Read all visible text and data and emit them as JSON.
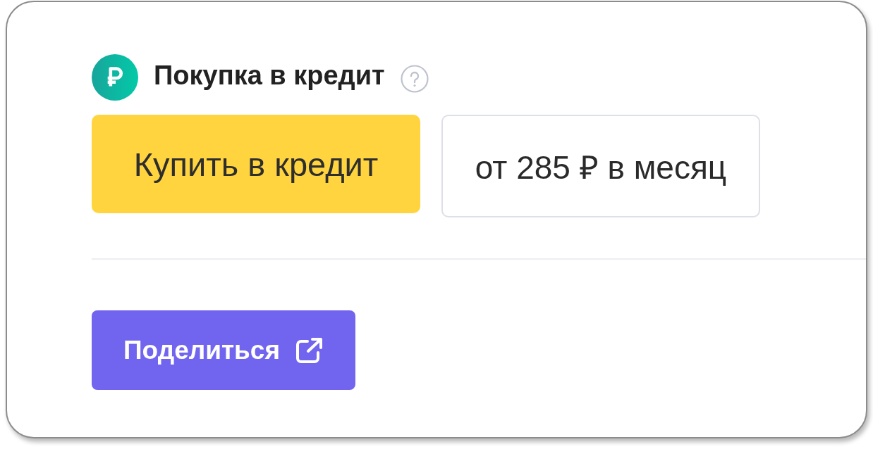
{
  "credit": {
    "title": "Покупка в кредит",
    "buy_button": "Купить в кредит",
    "monthly_price": "от 285 ₽ в месяц"
  },
  "share_button": {
    "label": "Поделиться"
  }
}
